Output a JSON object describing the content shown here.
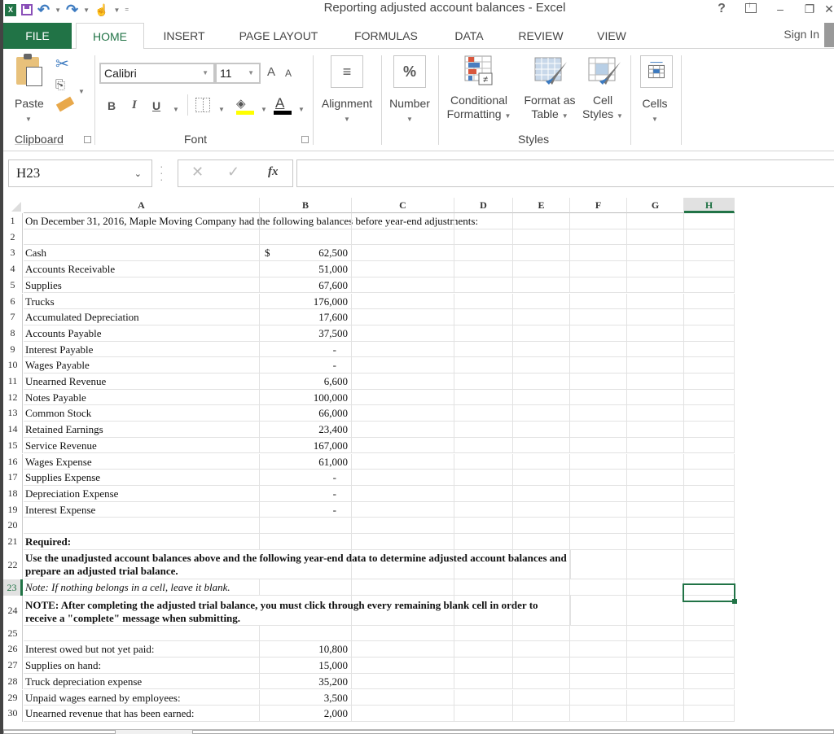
{
  "window": {
    "title": "Reporting adjusted account balances - Excel",
    "help": "?",
    "minimize": "–",
    "restore": "❐",
    "close": "✕"
  },
  "quick_access": {
    "app_icon": "X",
    "undo": "↶",
    "redo": "↷",
    "touch": "☝",
    "customize": "="
  },
  "tabs": [
    "FILE",
    "HOME",
    "INSERT",
    "PAGE LAYOUT",
    "FORMULAS",
    "DATA",
    "REVIEW",
    "VIEW"
  ],
  "active_tab": "HOME",
  "sign_in": "Sign In",
  "ribbon": {
    "clipboard": {
      "label": "Clipboard",
      "paste": "Paste",
      "cut": "✂",
      "copy": "⎘"
    },
    "font": {
      "label": "Font",
      "name": "Calibri",
      "size": "11",
      "grow": "A",
      "shrink": "A",
      "bold": "B",
      "italic": "I",
      "underline": "U",
      "fill": "◈",
      "color": "A",
      "fill_color": "#ffff00",
      "font_color": "#000000"
    },
    "alignment": {
      "label": "Alignment",
      "icon": "≡"
    },
    "number": {
      "label": "Number",
      "icon": "%"
    },
    "styles": {
      "label": "Styles",
      "conditional_line1": "Conditional",
      "conditional_line2": "Formatting",
      "format_table_line1": "Format as",
      "format_table_line2": "Table",
      "cell_styles_line1": "Cell",
      "cell_styles_line2": "Styles"
    },
    "cells": {
      "label": "Cells"
    }
  },
  "formula_bar": {
    "name_box": "H23",
    "cancel": "✕",
    "enter": "✓",
    "fx": "fx",
    "value": ""
  },
  "columns": [
    "A",
    "B",
    "C",
    "D",
    "E",
    "F",
    "G",
    "H"
  ],
  "selected_column": "H",
  "selected_row": "23",
  "sheet": {
    "intro": "On December 31, 2016, Maple Moving Company had the following balances before year-end adjustments:",
    "currency_symbol": "$",
    "balances": [
      {
        "row": "3",
        "account": "Cash",
        "amount": "62,500"
      },
      {
        "row": "4",
        "account": "Accounts Receivable",
        "amount": "51,000"
      },
      {
        "row": "5",
        "account": "Supplies",
        "amount": "67,600"
      },
      {
        "row": "6",
        "account": "Trucks",
        "amount": "176,000"
      },
      {
        "row": "7",
        "account": "Accumulated Depreciation",
        "amount": "17,600"
      },
      {
        "row": "8",
        "account": "Accounts Payable",
        "amount": "37,500"
      },
      {
        "row": "9",
        "account": "Interest Payable",
        "amount": "-"
      },
      {
        "row": "10",
        "account": "Wages Payable",
        "amount": "-"
      },
      {
        "row": "11",
        "account": "Unearned Revenue",
        "amount": "6,600"
      },
      {
        "row": "12",
        "account": "Notes Payable",
        "amount": "100,000"
      },
      {
        "row": "13",
        "account": "Common Stock",
        "amount": "66,000"
      },
      {
        "row": "14",
        "account": "Retained Earnings",
        "amount": "23,400"
      },
      {
        "row": "15",
        "account": "Service Revenue",
        "amount": "167,000"
      },
      {
        "row": "16",
        "account": "Wages Expense",
        "amount": "61,000"
      },
      {
        "row": "17",
        "account": "Supplies Expense",
        "amount": "-"
      },
      {
        "row": "18",
        "account": "Depreciation Expense",
        "amount": "-"
      },
      {
        "row": "19",
        "account": "Interest Expense",
        "amount": "-"
      }
    ],
    "required": "Required:",
    "instruction": "Use the unadjusted account balances above and the following year-end data to determine adjusted account balances and prepare an adjusted trial balance.",
    "note": "Note: If nothing belongs in a cell, leave it blank.",
    "note2": "NOTE: After completing the adjusted trial balance, you must click through every remaining blank cell in order to receive a \"complete\" message when submitting.",
    "adjustments": [
      {
        "row": "26",
        "description": "Interest owed but not yet paid:",
        "amount": "10,800"
      },
      {
        "row": "27",
        "description": "Supplies on hand:",
        "amount": "15,000"
      },
      {
        "row": "28",
        "description": "Truck depreciation expense",
        "amount": "35,200"
      },
      {
        "row": "29",
        "description": "Unpaid wages earned by employees:",
        "amount": "3,500"
      },
      {
        "row": "30",
        "description": "Unearned revenue that has been earned:",
        "amount": "2,000"
      }
    ]
  }
}
